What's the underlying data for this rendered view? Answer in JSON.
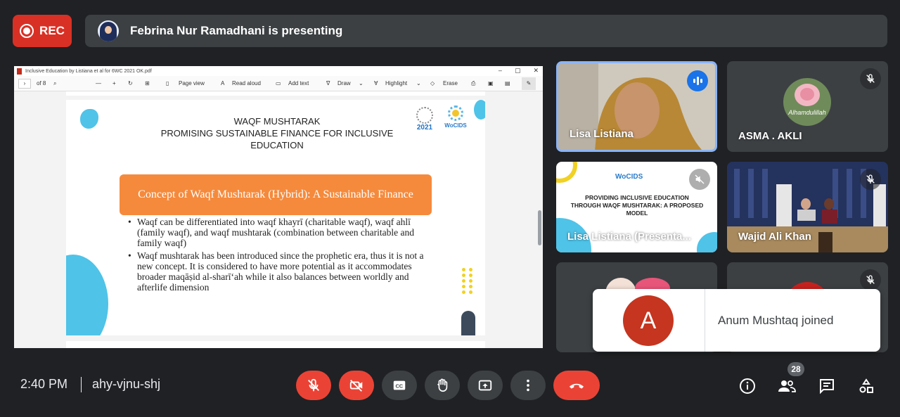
{
  "top_bar": {
    "rec_label": "REC",
    "presenting_text": "Febrina Nur Ramadhani is presenting"
  },
  "pdf_viewer": {
    "window_title": "Inclusive Education by Listiana et al for 6WC 2021 OK.pdf",
    "page_indicator": "of 8",
    "toolbar": {
      "page_view": "Page view",
      "read_aloud": "Read aloud",
      "add_text": "Add text",
      "draw": "Draw",
      "highlight": "Highlight",
      "erase": "Erase"
    }
  },
  "slide": {
    "title_line1": "WAQF MUSHTARAK",
    "title_line2": "PROMISING SUSTAINABLE FINANCE FOR INCLUSIVE EDUCATION",
    "logo_year": "2021",
    "logo_name": "WoCIDS",
    "concept_heading": "Concept of Waqf Mushtarak (Hybrid): A Sustainable Finance",
    "bullets": [
      "Waqf can be differentiated into waqf khayrī (charitable waqf), waqf ahlī (family waqf), and waqf mushtarak (combination between charitable and family waqf)",
      "Waqf mushtarak has been introduced since the prophetic era, thus it is not a new concept. It is considered to have more potential as it accommodates broader maqāṣid al-sharī‘ah while it also balances between worldly and afterlife dimension"
    ]
  },
  "participants": [
    {
      "name": "Lisa Listiana",
      "speaking": true
    },
    {
      "name": "ASMA . AKLI",
      "avatar_text": "Alhamdulillah",
      "muted": true
    },
    {
      "name": "Lisa Listiana (Presenta...",
      "muted": true,
      "thumb_logo": "WoCIDS",
      "thumb_title": "PROVIDING INCLUSIVE EDUCATION THROUGH WAQF MUSHTARAK: A PROPOSED MODEL"
    },
    {
      "name": "Wajid Ali Khan",
      "muted": true
    },
    {
      "name": "",
      "muted": false
    },
    {
      "name": "",
      "muted": true
    }
  ],
  "toast": {
    "avatar_letter": "A",
    "message": "Anum Mushtaq joined"
  },
  "bottom_bar": {
    "time": "2:40 PM",
    "meeting_code": "ahy-vjnu-shj",
    "people_count": "28"
  },
  "colors": {
    "background": "#202124",
    "rec_red": "#d93025",
    "control_red": "#ea4335",
    "control_grey": "#3c4043",
    "speaking_blue": "#1a73e8",
    "concept_orange": "#f58a3c",
    "slide_blue": "#4fc3e8",
    "toast_avatar": "#c5351f"
  },
  "icons": [
    "record-icon",
    "mic-off-icon",
    "camera-off-icon",
    "captions-icon",
    "raise-hand-icon",
    "present-icon",
    "more-options-icon",
    "end-call-icon",
    "info-icon",
    "people-icon",
    "chat-icon",
    "activities-icon"
  ]
}
